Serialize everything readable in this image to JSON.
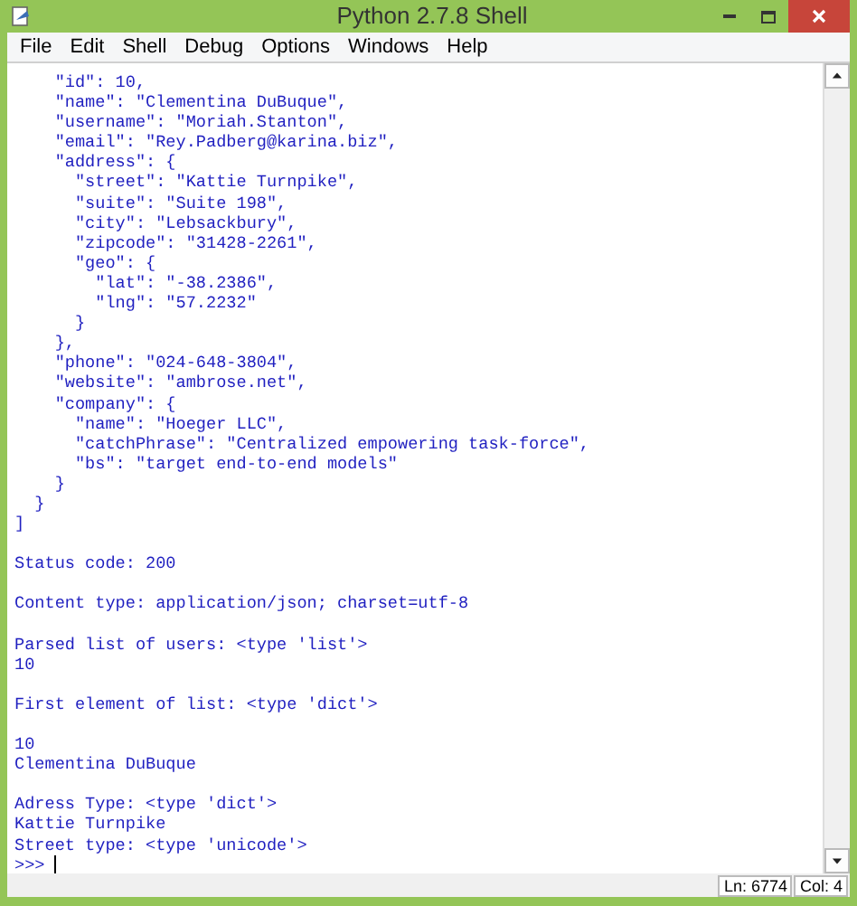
{
  "window": {
    "title": "Python 2.7.8 Shell"
  },
  "menu": [
    "File",
    "Edit",
    "Shell",
    "Debug",
    "Options",
    "Windows",
    "Help"
  ],
  "output_blocks": [
    [
      "    \"id\": 10,",
      "    \"name\": \"Clementina DuBuque\",",
      "    \"username\": \"Moriah.Stanton\",",
      "    \"email\": \"Rey.Padberg@karina.biz\",",
      "    \"address\": {",
      "      \"street\": \"Kattie Turnpike\",",
      "      \"suite\": \"Suite 198\",",
      "      \"city\": \"Lebsackbury\",",
      "      \"zipcode\": \"31428-2261\",",
      "      \"geo\": {",
      "        \"lat\": \"-38.2386\",",
      "        \"lng\": \"57.2232\"",
      "      }",
      "    },",
      "    \"phone\": \"024-648-3804\",",
      "    \"website\": \"ambrose.net\",",
      "    \"company\": {",
      "      \"name\": \"Hoeger LLC\",",
      "      \"catchPhrase\": \"Centralized empowering task-force\",",
      "      \"bs\": \"target end-to-end models\"",
      "    }",
      "  }",
      "]"
    ],
    [
      "Status code: 200"
    ],
    [
      "Content type: application/json; charset=utf-8"
    ],
    [
      "Parsed list of users: <type 'list'>",
      "10"
    ],
    [
      "First element of list: <type 'dict'>"
    ],
    [
      "10",
      "Clementina DuBuque"
    ],
    [
      "Adress Type: <type 'dict'>",
      "Kattie Turnpike",
      "Street type: <type 'unicode'>"
    ]
  ],
  "prompt": ">>>",
  "status_bar": [
    "Ln: 6774",
    "Col: 4"
  ]
}
